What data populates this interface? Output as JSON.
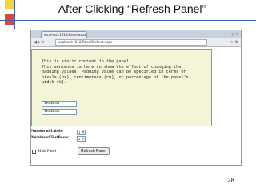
{
  "slide": {
    "title": "After Clicking “Refresh Panel”",
    "page_number": "28"
  },
  "browser": {
    "tab_title": "localhost:1612/Panel.aspx",
    "url": "localhost:1612/Panel/Default.aspx"
  },
  "panel": {
    "text_lines": [
      "This is static content in the panel.",
      "This sentence is here to show the effect of changing the",
      "padding values. Padding value can be specified in terms of",
      "pixels (px), centimeters (cm), or percentage of the panel's",
      "width (%)."
    ],
    "textboxes": [
      "TextBox1",
      "TextBox2"
    ]
  },
  "controls": {
    "labels_label": "Number of Labels:",
    "labels_value": "1",
    "textboxes_label": "Number of TextBoxes:",
    "textboxes_value": "2",
    "hide_panel_label": "Hide Panel",
    "refresh_button_label": "Refresh Panel"
  }
}
